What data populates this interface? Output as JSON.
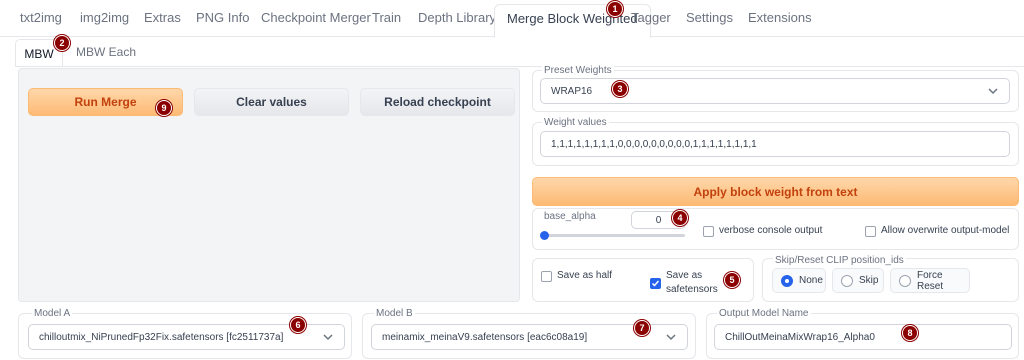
{
  "top_tabs": [
    "txt2img",
    "img2img",
    "Extras",
    "PNG Info",
    "Checkpoint Merger",
    "Train",
    "Depth Library",
    "Merge Block Weighted",
    "Tagger",
    "Settings",
    "Extensions"
  ],
  "sub_tabs": [
    "MBW",
    "MBW Each"
  ],
  "buttons": {
    "run_merge": "Run Merge",
    "clear_values": "Clear values",
    "reload_checkpoint": "Reload checkpoint",
    "apply_block_weight": "Apply block weight from text"
  },
  "preset_weights": {
    "label": "Preset Weights",
    "value": "WRAP16"
  },
  "weight_values": {
    "label": "Weight values",
    "value": "1,1,1,1,1,1,1,1,0,0,0,0,0,0,0,0,0,1,1,1,1,1,1,1,1"
  },
  "base_alpha": {
    "label": "base_alpha",
    "value": "0",
    "slider_fraction": 0
  },
  "checkboxes": {
    "verbose": {
      "label": "verbose console output",
      "checked": false
    },
    "allow_overwrite": {
      "label": "Allow overwrite output-model",
      "checked": false
    },
    "save_as_half": {
      "label": "Save as half",
      "checked": false
    },
    "save_as_safetensors": {
      "label": "Save as safetensors",
      "checked": true
    }
  },
  "skip_reset": {
    "label": "Skip/Reset CLIP position_ids",
    "options": [
      "None",
      "Skip",
      "Force Reset"
    ],
    "selected": "None"
  },
  "model_a": {
    "label": "Model A",
    "value": "chilloutmix_NiPrunedFp32Fix.safetensors [fc2511737a]"
  },
  "model_b": {
    "label": "Model B",
    "value": "meinamix_meinaV9.safetensors [eac6c08a19]"
  },
  "output_model": {
    "label": "Output Model Name",
    "value": "ChillOutMeinaMixWrap16_Alpha0"
  },
  "markers": [
    "1",
    "2",
    "3",
    "4",
    "5",
    "6",
    "7",
    "8",
    "9"
  ],
  "colors": {
    "accent_orange": "#fdba74",
    "accent_blue": "#2563eb",
    "marker_red": "#8b0000"
  }
}
